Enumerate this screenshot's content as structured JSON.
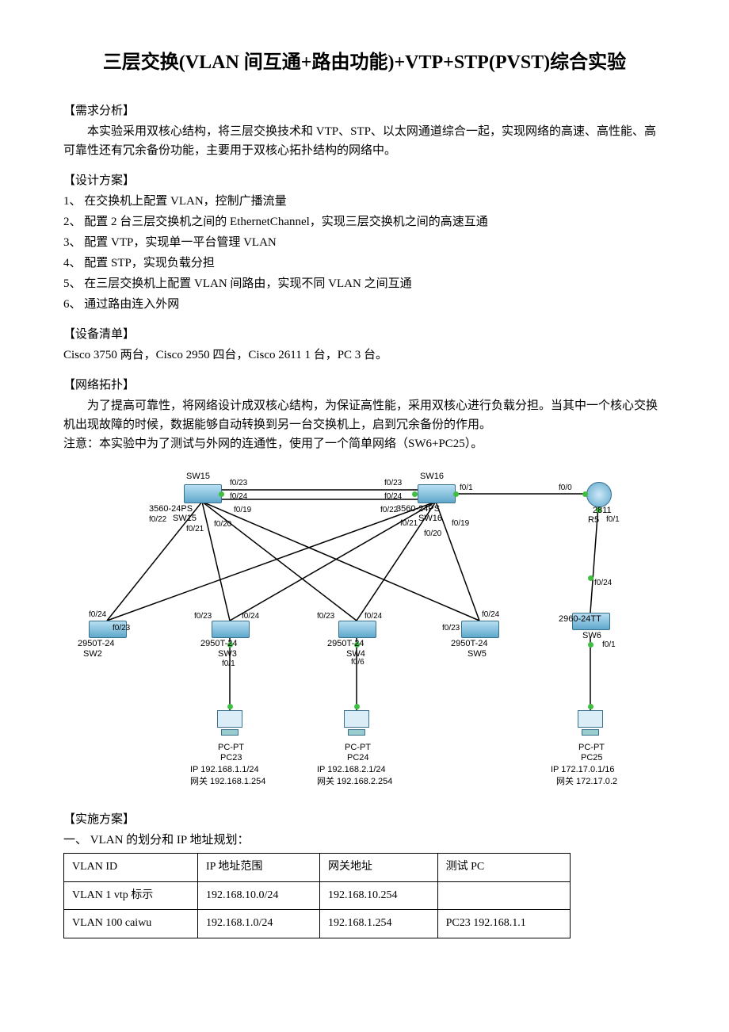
{
  "title": "三层交换(VLAN 间互通+路由功能)+VTP+STP(PVST)综合实验",
  "sections": {
    "req_label": "【需求分析】",
    "req_body": "本实验采用双核心结构，将三层交换技术和 VTP、STP、以太网通道综合一起，实现网络的高速、高性能、高可靠性还有冗余备份功能，主要用于双核心拓扑结构的网络中。",
    "plan_label": "【设计方案】",
    "plan_items": [
      "1、 在交换机上配置 VLAN，控制广播流量",
      "2、 配置 2 台三层交换机之间的 EthernetChannel，实现三层交换机之间的高速互通",
      "3、 配置 VTP，实现单一平台管理 VLAN",
      "4、 配置 STP，实现负载分担",
      "5、 在三层交换机上配置 VLAN 间路由，实现不同 VLAN 之间互通",
      "6、 通过路由连入外网"
    ],
    "dev_label": "【设备清单】",
    "dev_body": "Cisco 3750  两台，Cisco 2950  四台，Cisco 2611 1 台，PC 3 台。",
    "topo_label": "【网络拓扑】",
    "topo_body1": "为了提高可靠性，将网络设计成双核心结构，为保证高性能，采用双核心进行负载分担。当其中一个核心交换机出现故障的时候，数据能够自动转换到另一台交换机上，启到冗余备份的作用。",
    "topo_body2": "注意：本实验中为了测试与外网的连通性，使用了一个简单网络（SW6+PC25）。",
    "impl_label": "【实施方案】",
    "impl_sub": "一、 VLAN 的划分和 IP 地址规划："
  },
  "diagram": {
    "nodes": {
      "sw15": {
        "label_top": "SW15",
        "label_model": "3560-24PS",
        "label_sub": "SW15"
      },
      "sw16": {
        "label_top": "SW16",
        "label_model": "3560-24PS",
        "label_sub": "SW16"
      },
      "sw2": {
        "model": "2950T-24",
        "name": "SW2"
      },
      "sw3": {
        "model": "2950T-24",
        "name": "SW3"
      },
      "sw4": {
        "model": "2950T-24",
        "name": "SW4"
      },
      "sw5": {
        "model": "2950T-24",
        "name": "SW5"
      },
      "sw6": {
        "model": "2960-24TT",
        "name": "SW6"
      },
      "r5": {
        "model": "2811",
        "name": "R5"
      },
      "pc23": {
        "model": "PC-PT",
        "name": "PC23",
        "ip": "IP 192.168.1.1/24",
        "gw": "网关 192.168.1.254"
      },
      "pc24": {
        "model": "PC-PT",
        "name": "PC24",
        "ip": "IP 192.168.2.1/24",
        "gw": "网关 192.168.2.254"
      },
      "pc25": {
        "model": "PC-PT",
        "name": "PC25",
        "ip": "IP 172.17.0.1/16",
        "gw": "网关 172.17.0.2"
      }
    },
    "ports": {
      "sw15_f023": "f0/23",
      "sw15_f024": "f0/24",
      "sw15_f019": "f0/19",
      "sw15_f020": "f0/20",
      "sw15_f021": "f0/21",
      "sw15_f022": "f0/22",
      "sw16_f023": "f0/23",
      "sw16_f024": "f0/24",
      "sw16_f01": "f0/1",
      "sw16_f019": "f0/19",
      "sw16_f020": "f0/20",
      "sw16_f021": "f0/21",
      "sw16_f022": "f0/22",
      "r5_f00": "f0/0",
      "r5_f01": "f0/1",
      "sw6_f024": "f0/24",
      "sw6_f01": "f0/1",
      "sw2_f024": "f0/24",
      "sw2_f023": "f0/23",
      "sw3_f023": "f0/23",
      "sw3_f024": "f0/24",
      "sw3_f01": "f0/1",
      "sw4_f023": "f0/23",
      "sw4_f024": "f0/24",
      "sw4_f06": "f0/6",
      "sw5_f023": "f0/23",
      "sw5_f024": "f0/24"
    }
  },
  "table": {
    "headers": [
      "VLAN ID",
      "IP 地址范围",
      "网关地址",
      "测试 PC"
    ],
    "rows": [
      [
        "VLAN 1      vtp 标示",
        "192.168.10.0/24",
        "192.168.10.254",
        ""
      ],
      [
        "VLAN 100    caiwu",
        "192.168.1.0/24",
        "192.168.1.254",
        "PC23    192.168.1.1"
      ]
    ]
  }
}
